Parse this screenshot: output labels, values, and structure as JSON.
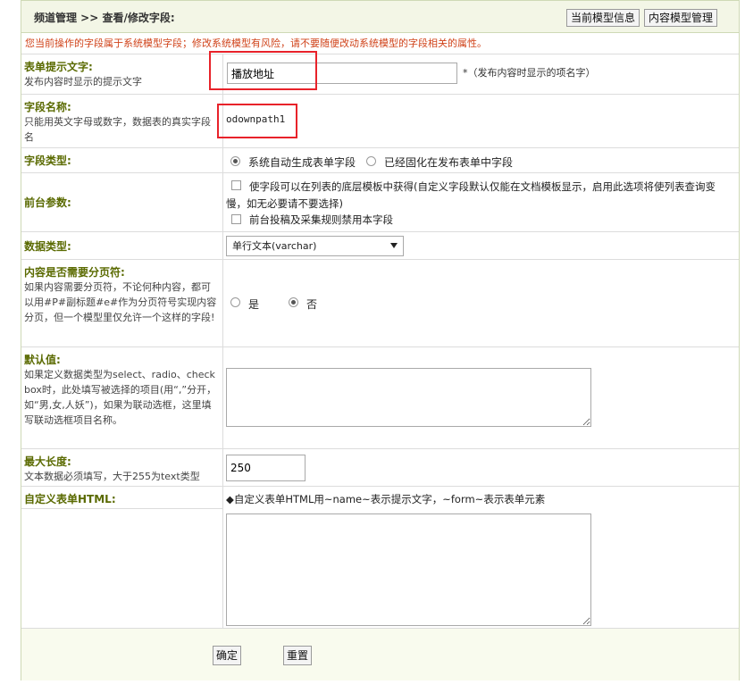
{
  "header": {
    "title": "频道管理 >> 查看/修改字段:",
    "btn_model_info": "当前模型信息",
    "btn_model_manage": "内容模型管理"
  },
  "warning": "您当前操作的字段属于系统模型字段；修改系统模型有风险，请不要随便改动系统模型的字段相关的属性。",
  "form": {
    "prompt": {
      "label": "表单提示文字:",
      "desc": "发布内容时显示的提示文字",
      "value": "播放地址",
      "hint": "*（发布内容时显示的项名字）"
    },
    "fieldname": {
      "label": "字段名称:",
      "desc": "只能用英文字母或数字，数据表的真实字段名",
      "value": "odownpath1"
    },
    "fieldtype": {
      "label": "字段类型:",
      "opt1": "系统自动生成表单字段",
      "opt2": "已经固化在发布表单中字段"
    },
    "frontparams": {
      "label": "前台参数:",
      "check1": "使字段可以在列表的底层模板中获得(自定义字段默认仅能在文档模板显示，启用此选项将使列表查询变慢，如无必要请不要选择)",
      "check2": "前台投稿及采集规则禁用本字段"
    },
    "datatype": {
      "label": "数据类型:",
      "selected": "单行文本(varchar)"
    },
    "pagebreak": {
      "label": "内容是否需要分页符:",
      "desc": "如果内容需要分页符，不论何种内容，都可以用#P#副标题#e#作为分页符号实现内容分页，但一个模型里仅允许一个这样的字段!",
      "yes": "是",
      "no": "否"
    },
    "default": {
      "label": "默认值:",
      "desc": "如果定义数据类型为select、radio、checkbox时，此处填写被选择的项目(用“,”分开，如“男,女,人妖”)，如果为联动选框，这里填写联动选框项目名称。"
    },
    "maxlen": {
      "label": "最大长度:",
      "desc": "文本数据必须填写，大于255为text类型",
      "value": "250"
    },
    "customhtml": {
      "label": "自定义表单HTML:",
      "hint": "◆自定义表单HTML用~name~表示提示文字，~form~表示表单元素"
    }
  },
  "footer": {
    "confirm": "确定",
    "reset": "重置"
  }
}
